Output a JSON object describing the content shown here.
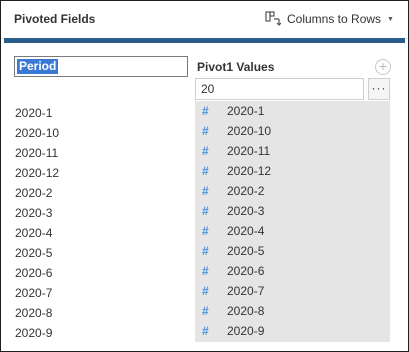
{
  "header": {
    "title": "Pivoted Fields",
    "mode_label": "Columns to Rows"
  },
  "pivot": {
    "field_name": "Period",
    "values_header": "Pivot1 Values",
    "count": "20",
    "more_label": "···"
  },
  "left_items": [
    "2020-1",
    "2020-10",
    "2020-11",
    "2020-12",
    "2020-2",
    "2020-3",
    "2020-4",
    "2020-5",
    "2020-6",
    "2020-7",
    "2020-8",
    "2020-9"
  ],
  "right_items": [
    "2020-1",
    "2020-10",
    "2020-11",
    "2020-12",
    "2020-2",
    "2020-3",
    "2020-4",
    "2020-5",
    "2020-6",
    "2020-7",
    "2020-8",
    "2020-9"
  ],
  "icons": {
    "mode": "columns-to-rows-icon",
    "add": "plus-icon",
    "type": "number-hash-icon",
    "more": "ellipsis-icon",
    "caret": "chevron-down-icon"
  },
  "colors": {
    "accent_bar": "#2b5d8c",
    "selection": "#3a78d6",
    "hash": "#4a90d9",
    "values_bg": "#e5e5e5"
  }
}
